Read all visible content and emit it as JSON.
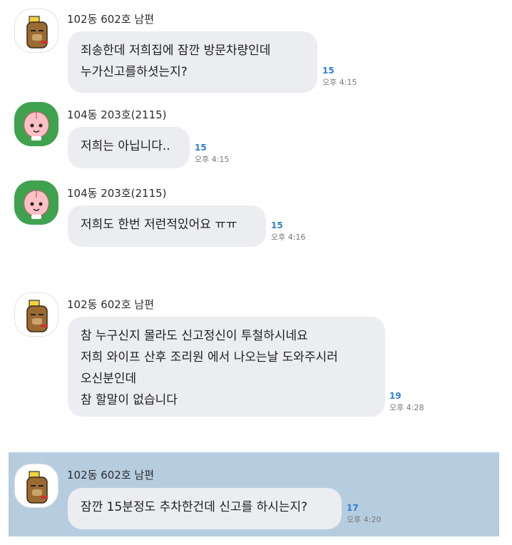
{
  "colors": {
    "bubble": "#ecedf1",
    "unread": "#2e7fd1",
    "highlight": "#b6cde0",
    "apeach_bg": "#3fa24e"
  },
  "messages": [
    {
      "sender": "102동 602호 남편",
      "avatar": "tube-character-icon",
      "lines": [
        "죄송한데 저희집에 잠깐 방문차량인데",
        "누가신고를하셧는지?"
      ],
      "unread": "15",
      "time": "오후 4:15"
    },
    {
      "sender": "104동 203호(2115)",
      "avatar": "apeach-character-icon",
      "lines": [
        "저희는 아닙니다.."
      ],
      "unread": "15",
      "time": "오후 4:15"
    },
    {
      "sender": "104동 203호(2115)",
      "avatar": "apeach-character-icon",
      "lines": [
        "저희도 한번 저런적있어요 ㅠㅠ"
      ],
      "unread": "15",
      "time": "오후 4:16"
    },
    {
      "sender": "102동 602호 남편",
      "avatar": "tube-character-icon",
      "lines": [
        "참 누구신지 몰라도 신고정신이 투철하시네요",
        "저희 와이프 산후 조리원 에서 나오는날 도와주시러",
        "오신분인데",
        "참 할말이 없습니다"
      ],
      "unread": "19",
      "time": "오후 4:28"
    },
    {
      "sender": "102동 602호 남편",
      "avatar": "tube-character-icon",
      "lines": [
        "잠깐 15분정도 추차한건데 신고를 하시는지?"
      ],
      "unread": "17",
      "time": "오후 4:20"
    }
  ]
}
